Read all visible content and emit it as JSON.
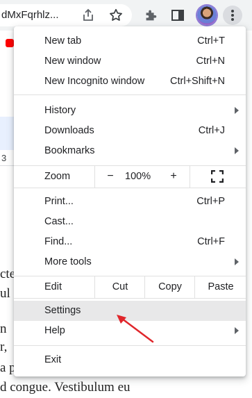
{
  "address_bar": {
    "url_fragment": "dMxFqrhlz..."
  },
  "toolbar_icons": [
    "share-icon",
    "star-icon",
    "puzzle-extension-icon",
    "side-panel-icon",
    "profile-avatar",
    "kebab-menu-icon"
  ],
  "background": {
    "ruler_number": "3",
    "doc_fragments": [
      "cte",
      "ul",
      "n",
      "r,",
      "a p",
      "d  congue.  Vestibulum  eu"
    ]
  },
  "menu": {
    "new_tab": {
      "label": "New tab",
      "shortcut": "Ctrl+T"
    },
    "new_window": {
      "label": "New window",
      "shortcut": "Ctrl+N"
    },
    "new_incognito": {
      "label": "New Incognito window",
      "shortcut": "Ctrl+Shift+N"
    },
    "history": {
      "label": "History"
    },
    "downloads": {
      "label": "Downloads",
      "shortcut": "Ctrl+J"
    },
    "bookmarks": {
      "label": "Bookmarks"
    },
    "zoom": {
      "label": "Zoom",
      "minus": "−",
      "value": "100%",
      "plus": "+"
    },
    "print": {
      "label": "Print...",
      "shortcut": "Ctrl+P"
    },
    "cast": {
      "label": "Cast..."
    },
    "find": {
      "label": "Find...",
      "shortcut": "Ctrl+F"
    },
    "more_tools": {
      "label": "More tools"
    },
    "edit": {
      "label": "Edit",
      "cut": "Cut",
      "copy": "Copy",
      "paste": "Paste"
    },
    "settings": {
      "label": "Settings"
    },
    "help": {
      "label": "Help"
    },
    "exit": {
      "label": "Exit"
    }
  },
  "colors": {
    "annotation_arrow": "#e0262b",
    "hover_bg": "#e8e8e9",
    "chrome_bg": "#f1f3f4"
  }
}
